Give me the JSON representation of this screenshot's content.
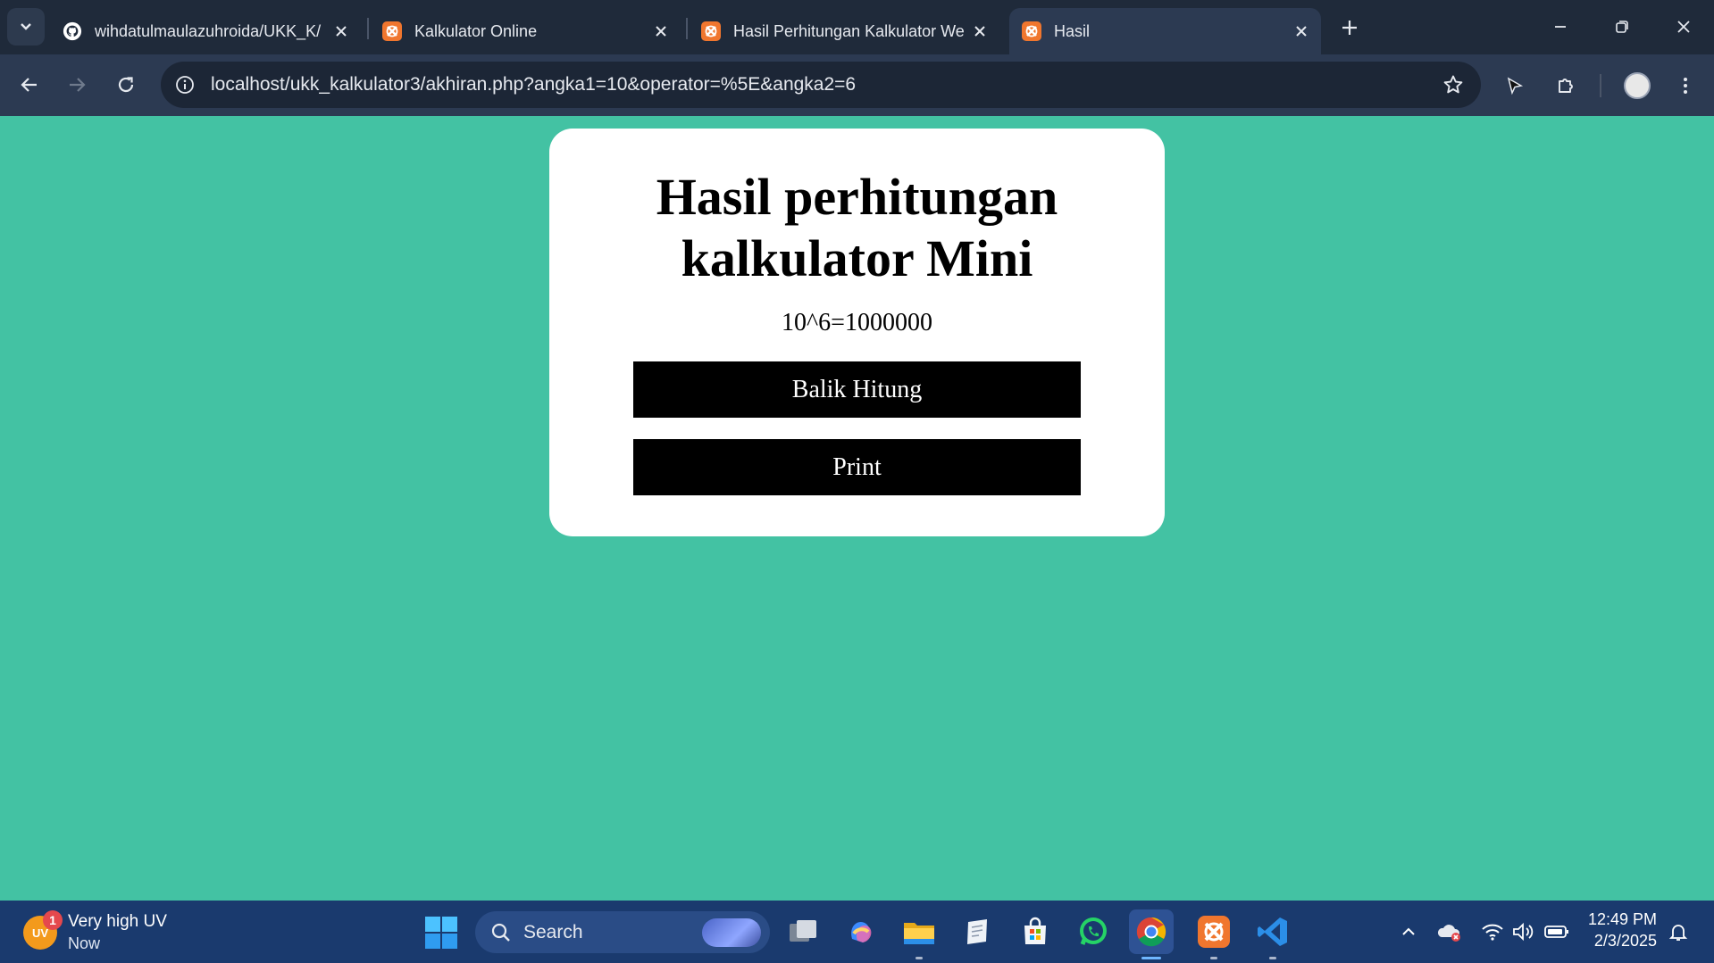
{
  "browser": {
    "tabs": [
      {
        "title": "wihdatulmaulazuhroida/UKK_K/",
        "icon": "github-icon"
      },
      {
        "title": "Kalkulator Online",
        "icon": "xampp-icon"
      },
      {
        "title": "Hasil Perhitungan Kalkulator We",
        "icon": "xampp-icon"
      },
      {
        "title": "Hasil",
        "icon": "xampp-icon",
        "active": true
      }
    ],
    "url": "localhost/ukk_kalkulator3/akhiran.php?angka1=10&operator=%5E&angka2=6"
  },
  "page": {
    "heading_line1": "Hasil perhitungan",
    "heading_line2": "kalkulator Mini",
    "result": "10^6=1000000",
    "buttons": {
      "back": "Balik Hitung",
      "print": "Print"
    }
  },
  "taskbar": {
    "weather": {
      "badge": "1",
      "icon_text": "UV",
      "title": "Very high UV",
      "subtitle": "Now"
    },
    "search_placeholder": "Search",
    "clock_time": "12:49 PM",
    "clock_date": "2/3/2025"
  },
  "colors": {
    "page_background": "#43c2a3",
    "card_background": "#ffffff",
    "button_background": "#000000",
    "browser_frame": "#1f2a3a",
    "taskbar": "#1a3a6e"
  }
}
